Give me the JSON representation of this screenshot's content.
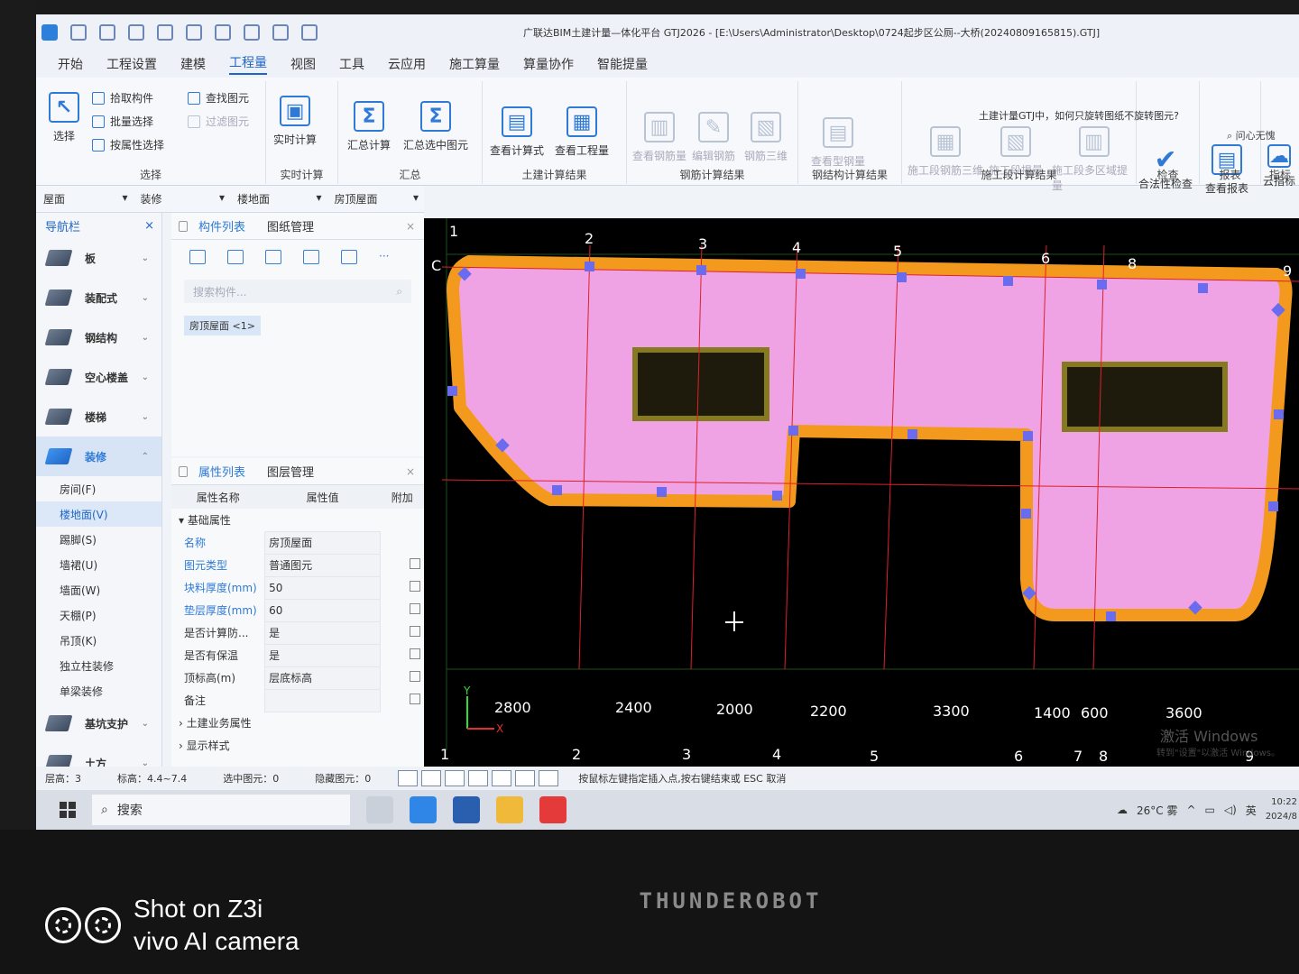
{
  "window": {
    "title": "广联达BIM土建计量—体化平台 GTJ2026 - [E:\\Users\\Administrator\\Desktop\\0724起步区公厕--大桥(20240809165815).GTJ]"
  },
  "menu": [
    "开始",
    "工程设置",
    "建模",
    "工程量",
    "视图",
    "工具",
    "云应用",
    "施工算量",
    "算量协作",
    "智能提量"
  ],
  "menu_active": "工程量",
  "ribbon": {
    "select_group": {
      "title": "选择",
      "big": "选择",
      "items": [
        "拾取构件",
        "批量选择",
        "按属性选择"
      ]
    },
    "find_group": {
      "items": [
        "查找图元",
        "过滤图元"
      ]
    },
    "realtime_group": {
      "title": "实时计算",
      "btn": "实时计算"
    },
    "summary_group": {
      "title": "汇总",
      "btns": [
        "汇总计算",
        "汇总选中图元"
      ]
    },
    "civil_group": {
      "title": "土建计算结果",
      "btns": [
        "查看计算式",
        "查看工程量"
      ]
    },
    "rebar_group": {
      "title": "钢筋计算结果",
      "btns": [
        "查看钢筋量",
        "编辑钢筋",
        "钢筋三维"
      ]
    },
    "steel_group": {
      "title": "钢结构计算结果",
      "btns": [
        "查看型钢量"
      ]
    },
    "const_group": {
      "title": "施工段计算结果",
      "btns": [
        "施工段钢筋三维",
        "施工段提量",
        "施工段多区域提量"
      ]
    },
    "check_group": {
      "title": "检查",
      "btns": [
        "合法性检查"
      ]
    },
    "report_group": {
      "title": "报表",
      "btns": [
        "查看报表"
      ]
    },
    "cloud_group": {
      "title": "指标",
      "btns": [
        "云指标"
      ]
    },
    "help_question": "土建计量GTJ中，如何只旋转图纸不旋转图元?",
    "help_search": "问心无愧"
  },
  "selectors": [
    "屋面",
    "装修",
    "楼地面",
    "房顶屋面"
  ],
  "nav": {
    "title": "导航栏",
    "categories": [
      "板",
      "装配式",
      "钢结构",
      "空心楼盖",
      "楼梯",
      "装修"
    ],
    "sub_items": [
      "房间(F)",
      "楼地面(V)",
      "踢脚(S)",
      "墙裙(U)",
      "墙面(W)",
      "天棚(P)",
      "吊顶(K)",
      "独立柱装修",
      "单梁装修"
    ],
    "active_sub": "楼地面(V)",
    "bottom": [
      "基坑支护",
      "土方"
    ]
  },
  "component_list": {
    "tabs": [
      "构件列表",
      "图纸管理"
    ],
    "search_placeholder": "搜索构件...",
    "item": "房顶屋面 <1>"
  },
  "property_list": {
    "tabs": [
      "属性列表",
      "图层管理"
    ],
    "headers": [
      "属性名称",
      "属性值",
      "附加"
    ],
    "section": "基础属性",
    "rows": [
      {
        "name": "名称",
        "value": "房顶屋面",
        "blue": true
      },
      {
        "name": "图元类型",
        "value": "普通图元",
        "blue": true
      },
      {
        "name": "块料厚度(mm)",
        "value": "50",
        "blue": true
      },
      {
        "name": "垫层厚度(mm)",
        "value": "60",
        "blue": true
      },
      {
        "name": "是否计算防...",
        "value": "是",
        "blue": false
      },
      {
        "name": "是否有保温",
        "value": "是",
        "blue": false
      },
      {
        "name": "顶标高(m)",
        "value": "层底标高",
        "blue": false
      },
      {
        "name": "备注",
        "value": "",
        "blue": false
      }
    ],
    "extra_sections": [
      "土建业务属性",
      "显示样式"
    ]
  },
  "canvas": {
    "top_axes": [
      "1",
      "2",
      "3",
      "4",
      "5",
      "6",
      "8",
      "9"
    ],
    "bottom_axes": [
      "1",
      "2",
      "3",
      "4",
      "5",
      "6",
      "7",
      "8",
      "9"
    ],
    "left_axis": "C",
    "spacings": [
      "2800",
      "2400",
      "2000",
      "2200",
      "3300",
      "1400",
      "600",
      "3600"
    ],
    "activate_windows": "激活 Windows",
    "activate_sub": "转到\"设置\"以激活 Windows。",
    "axis_x": "X",
    "axis_y": "Y"
  },
  "status": {
    "floor_height": "层高：3",
    "elevation": "标高：4.4~7.4",
    "selected": "选中图元：0",
    "hidden": "隐藏图元：0",
    "hint": "按鼠标左键指定插入点,按右键结束或 ESC 取消"
  },
  "taskbar": {
    "search": "搜索",
    "weather": "26°C 雾",
    "ime": "英",
    "time": "10:22",
    "date": "2024/8"
  },
  "photo": {
    "brand": "THUNDEROBOT",
    "camera_line1": "Shot on Z3i",
    "camera_line2": "vivo AI camera"
  }
}
